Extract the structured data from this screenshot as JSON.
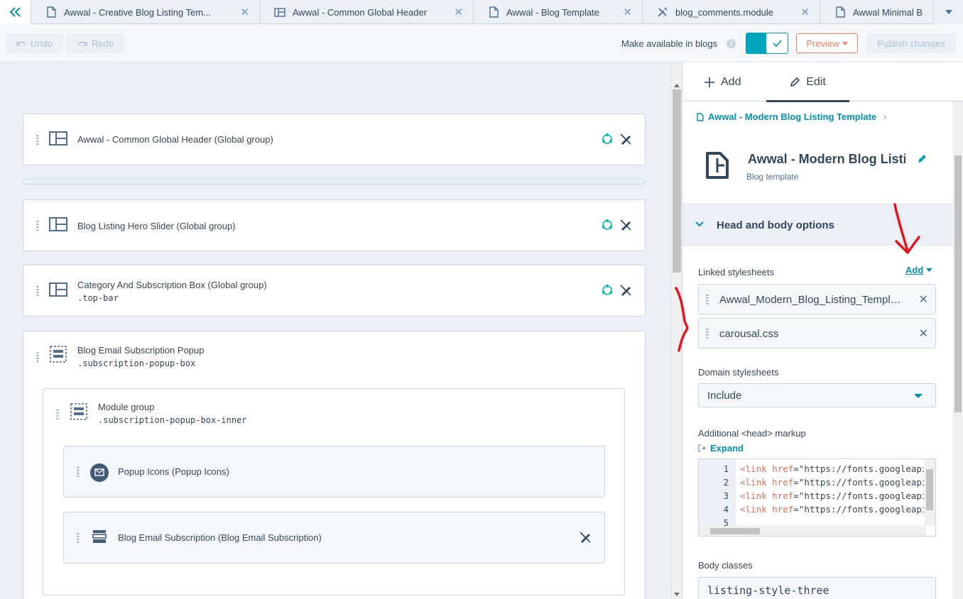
{
  "tabs": [
    {
      "icon": "document-icon",
      "label": "Awwal - Creative Blog Listing Tem..."
    },
    {
      "icon": "layout-icon",
      "label": "Awwal - Common Global Header"
    },
    {
      "icon": "document-icon",
      "label": "Awwal - Blog Template"
    },
    {
      "icon": "wrench-icon",
      "label": "blog_comments.module"
    },
    {
      "icon": "document-icon",
      "label": "Awwal Minimal B"
    }
  ],
  "toolbar": {
    "undo_label": "Undo",
    "redo_label": "Redo",
    "available_label": "Make available in blogs",
    "info": "i",
    "preview_label": "Preview",
    "publish_label": "Publish changes"
  },
  "canvas": {
    "modules": [
      {
        "title": "Awwal - Common Global Header (Global group)",
        "sub": ""
      },
      {
        "title": "Blog Listing Hero Slider (Global group)",
        "sub": ""
      },
      {
        "title": "Category And Subscription Box (Global group)",
        "sub": ".top-bar"
      },
      {
        "title": "Blog Email Subscription Popup",
        "sub": ".subscription-popup-box"
      }
    ],
    "group": {
      "title": "Module group",
      "sub": ".subscription-popup-box-inner"
    },
    "children": [
      {
        "title": "Popup Icons (Popup Icons)"
      },
      {
        "title": "Blog Email Subscription (Blog Email Subscription)"
      }
    ]
  },
  "sidebar": {
    "tab_add": "Add",
    "tab_edit": "Edit",
    "breadcrumb": "Awwal - Modern Blog Listing Template",
    "template_title": "Awwal - Modern Blog Listir",
    "template_type": "Blog template",
    "section_title": "Head and body options",
    "linked_label": "Linked stylesheets",
    "add_label": "Add",
    "stylesheets": [
      "Awwal_Modern_Blog_Listing_Template.css",
      "carousal.css"
    ],
    "domain_label": "Domain stylesheets",
    "domain_value": "Include",
    "head_label": "Additional <head> markup",
    "expand_label": "Expand",
    "code_lines": [
      {
        "num": "1",
        "tag": "<link",
        "attr": "href",
        "eq": "=",
        "str": "\"https://fonts.googleapis.com/css"
      },
      {
        "num": "2",
        "tag": "<link",
        "attr": "href",
        "eq": "=",
        "str": "\"https://fonts.googleapis.com/css"
      },
      {
        "num": "3",
        "tag": "<link",
        "attr": "href",
        "eq": "=",
        "str": "\"https://fonts.googleapis.com/css"
      },
      {
        "num": "4",
        "tag": "<link",
        "attr": "href",
        "eq": "=",
        "str": "\"https://fonts.googleapis.com/css"
      },
      {
        "num": "5",
        "tag": "",
        "attr": "",
        "eq": "",
        "str": ""
      }
    ],
    "body_label": "Body classes",
    "body_value": "listing-style-three"
  },
  "colors": {
    "accent": "#00a4bd",
    "link": "#0091ae",
    "preview": "#ff7a59",
    "annotation": "#e8141c"
  }
}
